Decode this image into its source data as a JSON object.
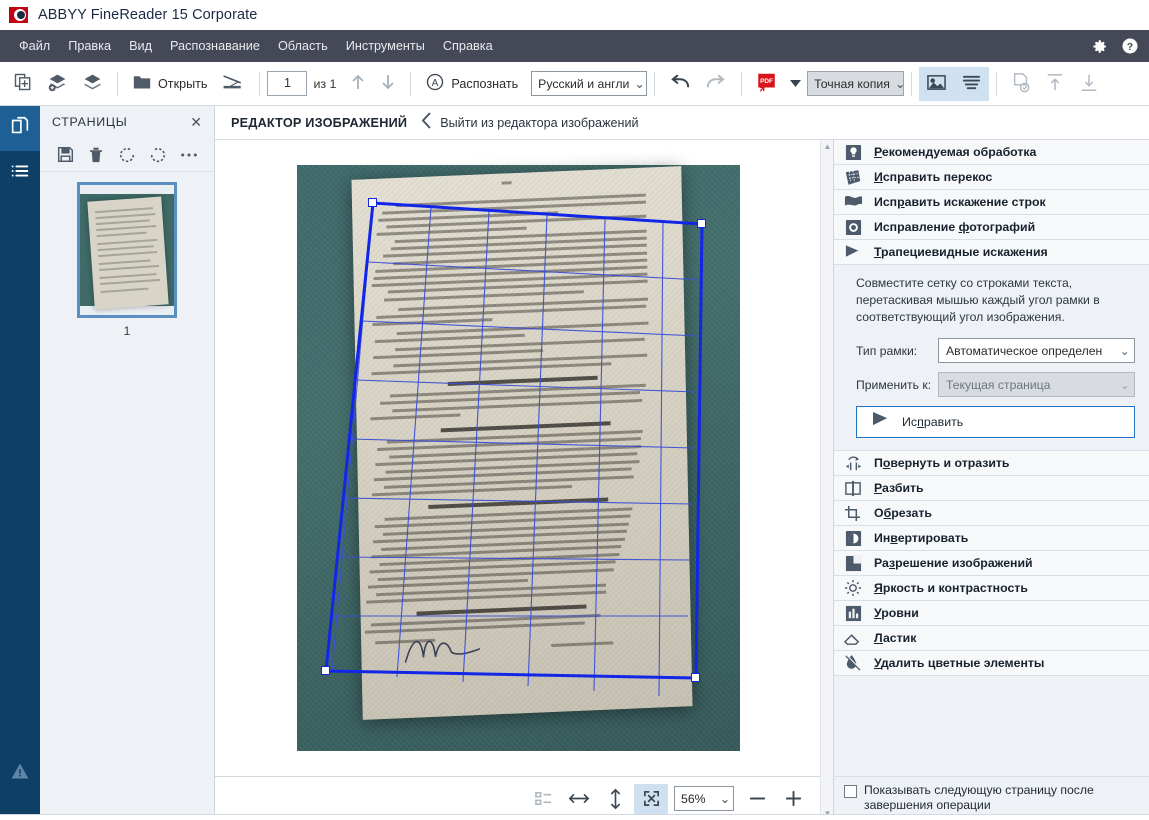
{
  "window": {
    "title": "ABBYY FineReader 15 Corporate",
    "logo_icon": "abbyy-eye-logo"
  },
  "menubar": {
    "items": [
      {
        "label": "Файл",
        "name": "menu-file"
      },
      {
        "label": "Правка",
        "name": "menu-edit"
      },
      {
        "label": "Вид",
        "name": "menu-view"
      },
      {
        "label": "Распознавание",
        "name": "menu-recognize"
      },
      {
        "label": "Область",
        "name": "menu-area"
      },
      {
        "label": "Инструменты",
        "name": "menu-tools"
      },
      {
        "label": "Справка",
        "name": "menu-help"
      }
    ],
    "settings_icon": "gear-icon",
    "help_icon": "question-circle-icon",
    "bg_color": "#454957"
  },
  "toolbar": {
    "add_pages_icon": "add-page-icon",
    "add_images_icon": "add-images-icon",
    "layers_icon": "layers-icon",
    "open_label": "Открыть",
    "open_icon": "folder-icon",
    "scan_icon": "scanner-icon",
    "page_current": "1",
    "page_of": "из 1",
    "prev_page_icon": "arrow-up-icon",
    "next_page_icon": "arrow-down-icon",
    "recognize_label": "Распознать",
    "recognize_icon": "recognize-a-icon",
    "language_value": "Русский и англи",
    "undo_icon": "undo-icon",
    "redo_icon": "redo-icon",
    "pdf_icon": "pdf-export-icon",
    "pdf_dropdown_icon": "caret-down-icon",
    "mode_value": "Точная копия",
    "view_image_icon": "image-view-icon",
    "view_text_icon": "text-view-icon",
    "verify_icon": "document-check-icon",
    "send_up_icon": "send-out-icon",
    "send_down_icon": "send-in-icon"
  },
  "rail": {
    "pages_icon": "documents-icon",
    "list_icon": "list-icon",
    "warning_icon": "warning-triangle-icon"
  },
  "pages_panel": {
    "title": "СТРАНИЦЫ",
    "close_icon": "close-icon",
    "tools": [
      {
        "name": "save-icon",
        "icon": "save-icon"
      },
      {
        "name": "delete-icon",
        "icon": "trash-icon"
      },
      {
        "name": "rotate-left-icon",
        "icon": "rotate-ccw-icon"
      },
      {
        "name": "rotate-right-icon",
        "icon": "rotate-cw-icon"
      },
      {
        "name": "more-options-icon",
        "icon": "ellipsis-icon"
      }
    ],
    "thumbnail_number": "1"
  },
  "editor_header": {
    "title": "РЕДАКТОР ИЗОБРАЖЕНИЙ",
    "back_icon": "chevron-left-icon",
    "exit_label": "Выйти из редактора изображений"
  },
  "canvas": {
    "grid_color": "#3b4fd8",
    "frame_color": "#1226e8",
    "handle_fill": "#ffffff",
    "zoom_value": "56%",
    "thumbs_icon": "thumbnails-icon",
    "fit_width_icon": "fit-width-icon",
    "fit_height_icon": "fit-height-icon",
    "fit_page_icon": "fit-page-icon",
    "zoom_out_icon": "minus-icon",
    "zoom_in_icon": "plus-icon",
    "zoom_dropdown_icon": "chevron-down-icon"
  },
  "right_panel": {
    "top_tools": [
      {
        "label": "Рекомендуемая обработка",
        "icon": "lightbulb-icon",
        "name": "tool-recommended-processing"
      },
      {
        "label": "Исправить перекос",
        "icon": "deskew-icon",
        "name": "tool-deskew"
      },
      {
        "label": "Исправить искажение строк",
        "icon": "straighten-lines-icon",
        "name": "tool-straighten-text-lines"
      },
      {
        "label": "Исправление фотографий",
        "icon": "camera-icon",
        "name": "tool-photo-correction"
      },
      {
        "label": "Трапециевидные искажения",
        "icon": "trapezoid-icon",
        "name": "tool-trapezoid-correction"
      }
    ],
    "expanded_panel": {
      "hint": "Совместите сетку со строками текста, перетаскивая мышью каждый угол рамки в соответствующий угол изображения.",
      "frame_type_label": "Тип рамки:",
      "frame_type_value": "Автоматическое определен",
      "apply_to_label": "Применить к:",
      "apply_to_value": "Текущая страница",
      "apply_button_label": "Исправить",
      "apply_button_icon": "trapezoid-icon"
    },
    "bottom_tools": [
      {
        "label": "Повернуть и отразить",
        "icon": "rotate-flip-icon",
        "name": "tool-rotate-and-flip"
      },
      {
        "label": "Разбить",
        "icon": "split-icon",
        "name": "tool-split"
      },
      {
        "label": "Обрезать",
        "icon": "crop-icon",
        "name": "tool-crop"
      },
      {
        "label": "Инвертировать",
        "icon": "invert-icon",
        "name": "tool-invert"
      },
      {
        "label": "Разрешение изображений",
        "icon": "resolution-icon",
        "name": "tool-image-resolution"
      },
      {
        "label": "Яркость и контрастность",
        "icon": "brightness-icon",
        "name": "tool-brightness-contrast"
      },
      {
        "label": "Уровни",
        "icon": "levels-icon",
        "name": "tool-levels"
      },
      {
        "label": "Ластик",
        "icon": "eraser-icon",
        "name": "tool-eraser"
      },
      {
        "label": "Удалить цветные элементы",
        "icon": "remove-color-icon",
        "name": "tool-remove-color-elements"
      }
    ],
    "footer_checkbox_label": "Показывать следующую страницу после завершения операции",
    "footer_checkbox_checked": false
  }
}
